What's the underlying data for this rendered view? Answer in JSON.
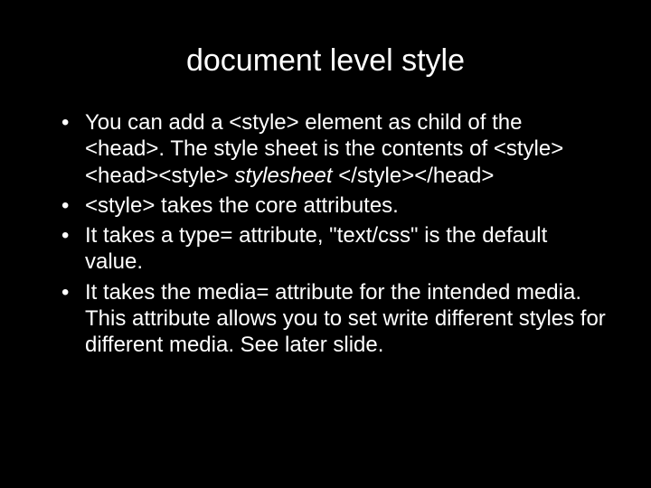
{
  "slide": {
    "title": "document level style",
    "bullets": [
      {
        "text_html": "You can add a &lt;style&gt; element as child of the &lt;head&gt;. The style sheet is the contents of &lt;style&gt;<br>&lt;head&gt;&lt;style&gt; <span class=\"italic\">stylesheet</span> &lt;/style&gt;&lt;/head&gt;"
      },
      {
        "text_html": "&lt;style&gt; takes the core attributes."
      },
      {
        "text_html": "It takes a type= attribute, \"text/css\" is the default value."
      },
      {
        "text_html": "It takes the media= attribute for the intended media. This attribute allows you to set write different styles for different media. See later slide."
      }
    ]
  }
}
